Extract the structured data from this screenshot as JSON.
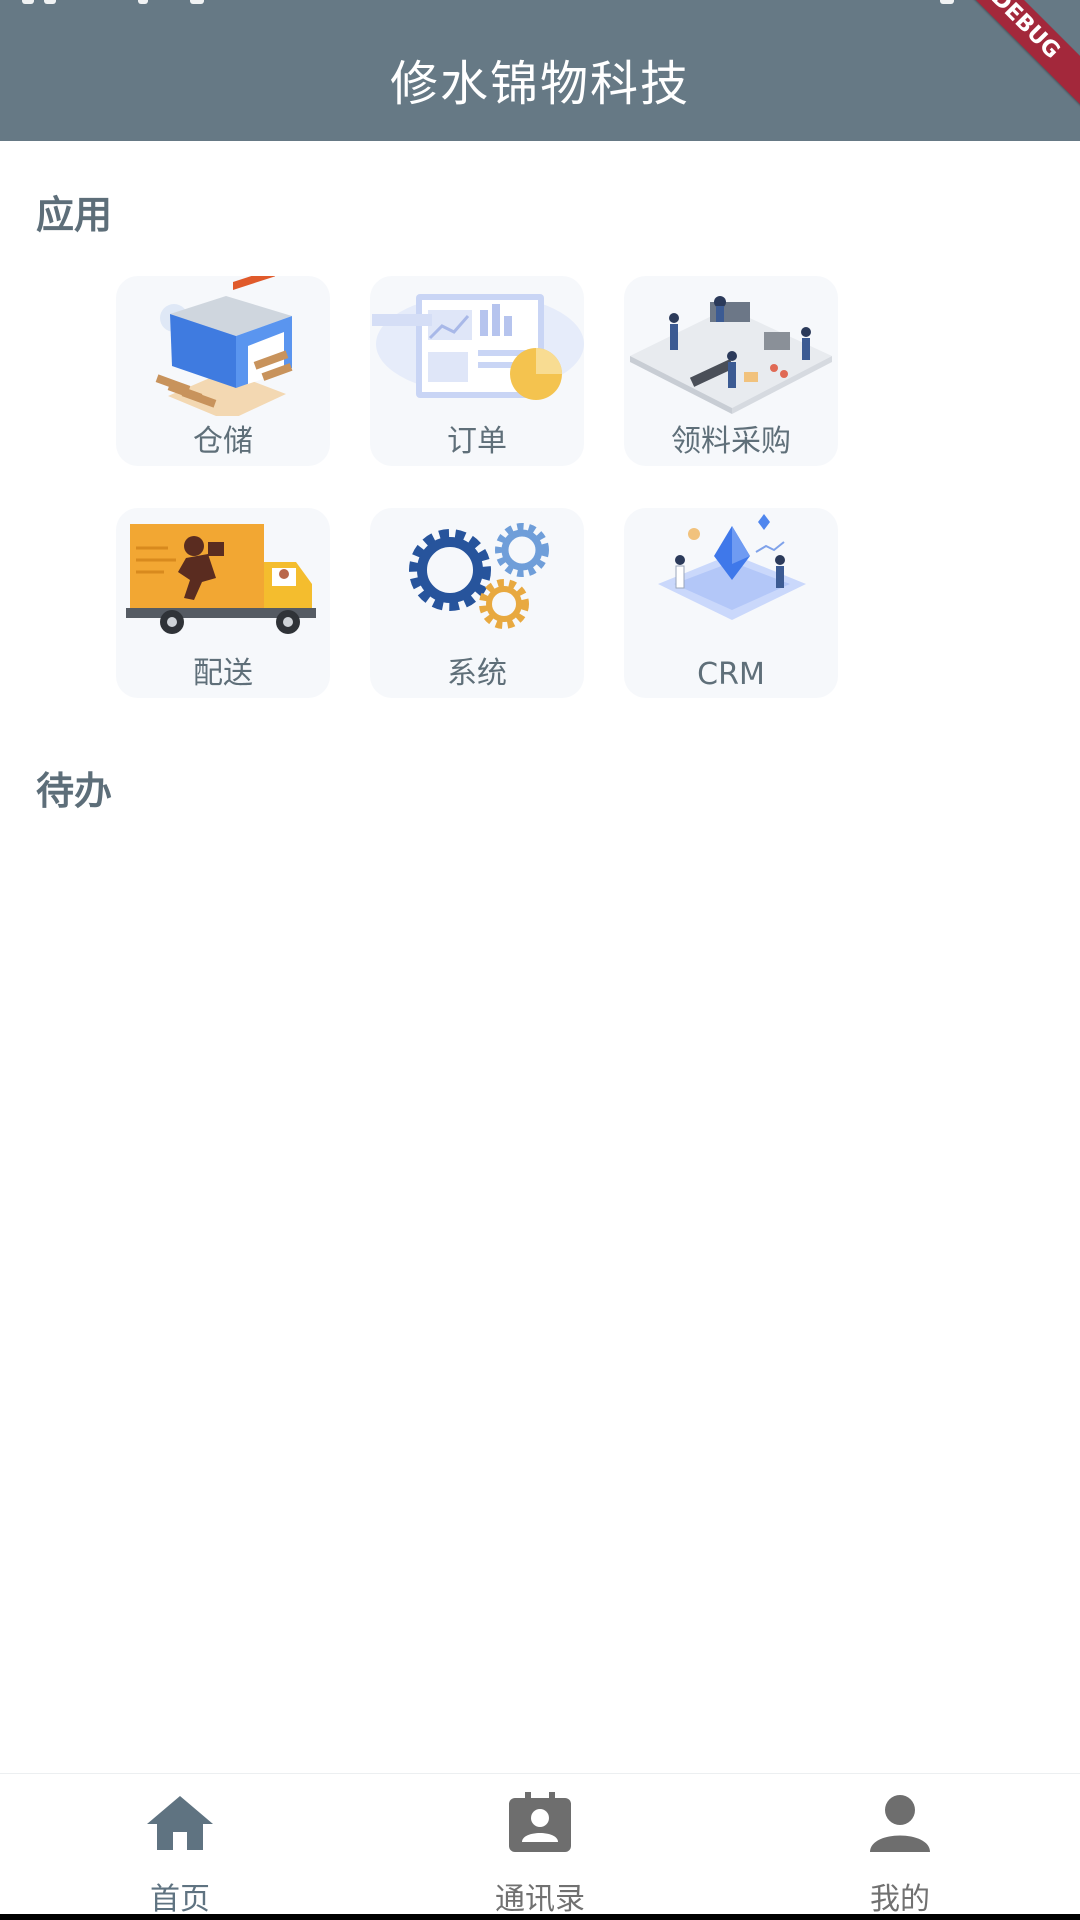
{
  "appbar": {
    "title": "修水锦物科技",
    "debug_label": "DEBUG"
  },
  "sections": {
    "apps_title": "应用",
    "todo_title": "待办"
  },
  "apps": [
    {
      "label": "仓储",
      "icon": "warehouse-icon"
    },
    {
      "label": "订单",
      "icon": "order-dashboard-icon"
    },
    {
      "label": "领料采购",
      "icon": "procurement-office-icon"
    },
    {
      "label": "配送",
      "icon": "delivery-truck-icon"
    },
    {
      "label": "系统",
      "icon": "gears-icon"
    },
    {
      "label": "CRM",
      "icon": "crm-crystal-icon"
    }
  ],
  "nav": {
    "items": [
      {
        "label": "首页",
        "icon": "home-icon",
        "active": true
      },
      {
        "label": "通讯录",
        "icon": "contacts-icon",
        "active": false
      },
      {
        "label": "我的",
        "icon": "person-icon",
        "active": false
      }
    ]
  },
  "colors": {
    "primary": "#667985",
    "nav_active": "#5f7381",
    "nav_inactive": "#717171",
    "debug": "#a3283b"
  }
}
